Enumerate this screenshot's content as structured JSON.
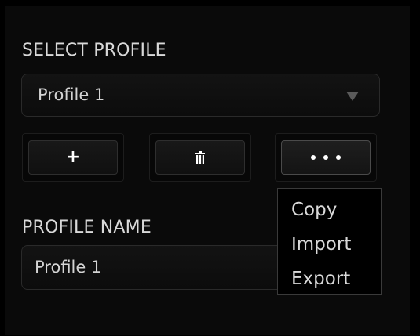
{
  "select_profile": {
    "label": "SELECT PROFILE",
    "selected": "Profile 1"
  },
  "actions": {
    "add": "+",
    "delete_icon": "trash-icon",
    "more_icon": "ellipsis-icon"
  },
  "profile_name": {
    "label": "PROFILE NAME",
    "value": "Profile 1"
  },
  "menu": {
    "items": [
      {
        "label": "Copy"
      },
      {
        "label": "Import"
      },
      {
        "label": "Export"
      }
    ]
  }
}
